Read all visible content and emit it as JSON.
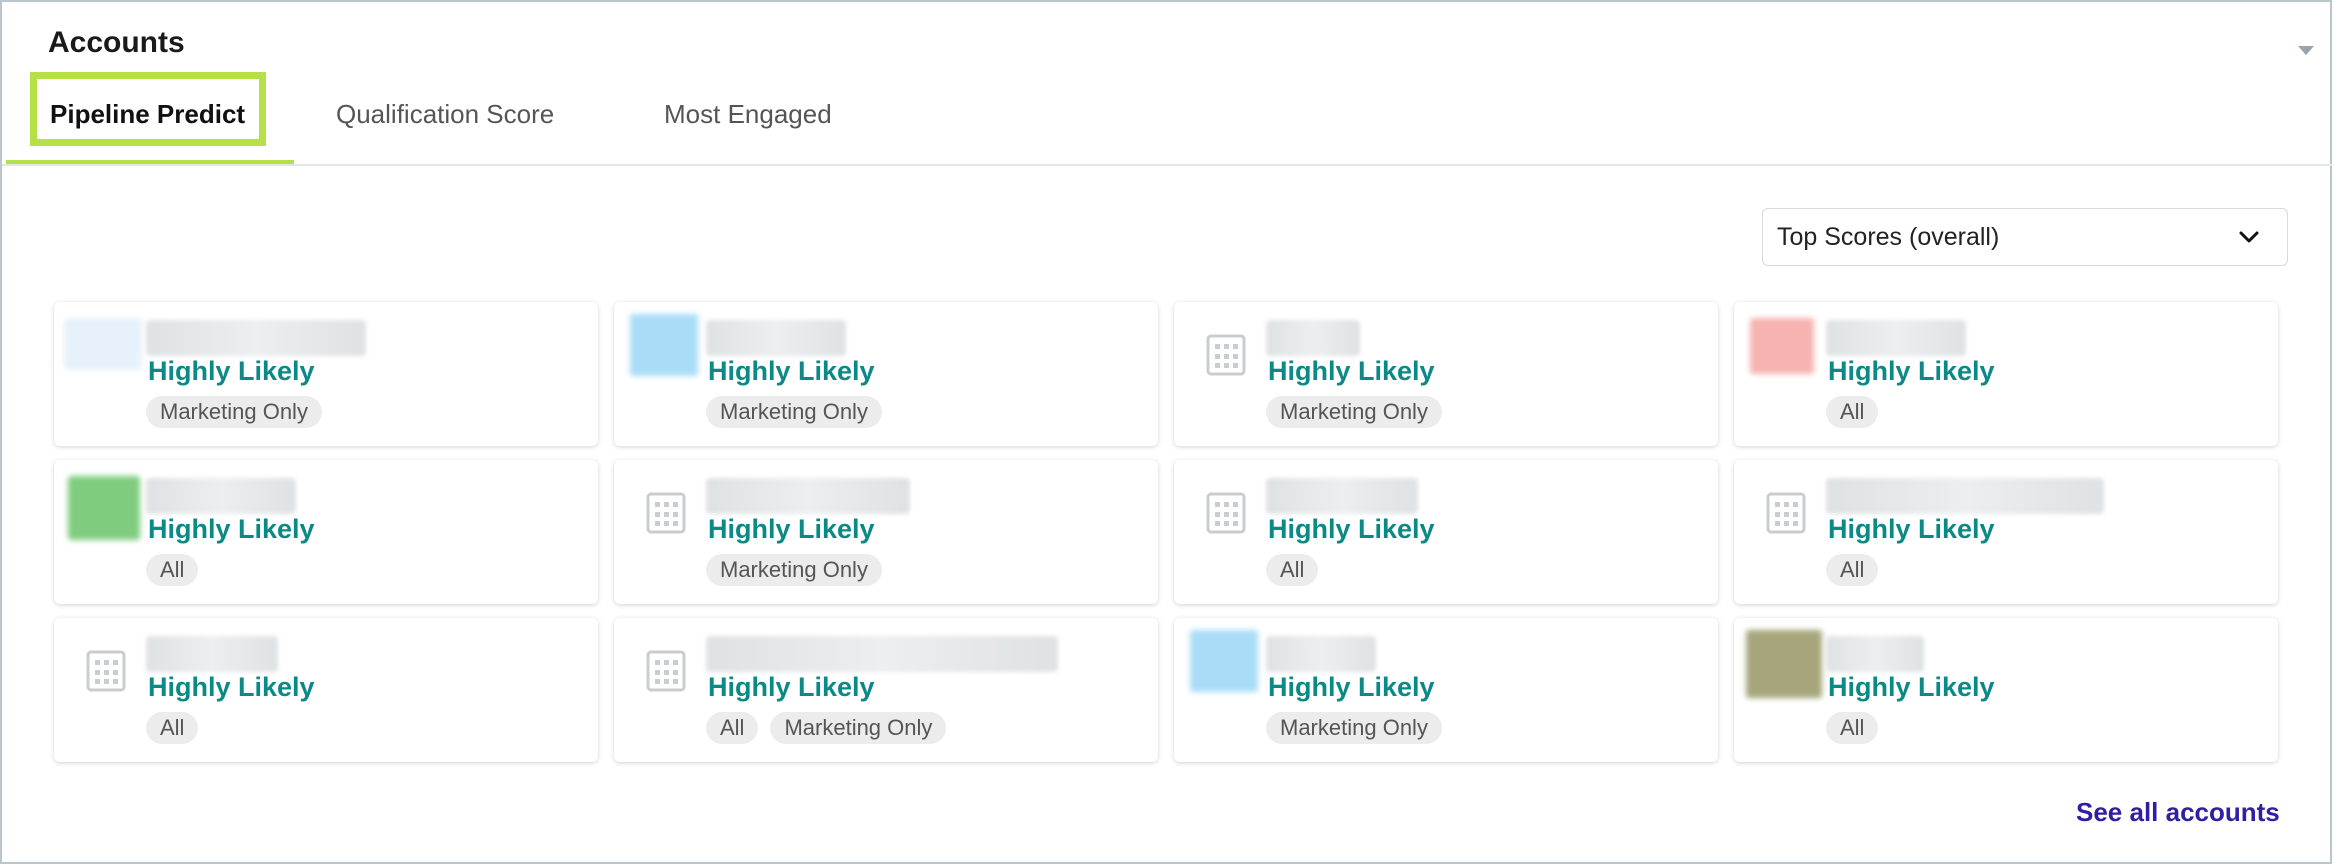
{
  "title": "Accounts",
  "tabs": [
    {
      "label": "Pipeline Predict",
      "active": true
    },
    {
      "label": "Qualification Score",
      "active": false
    },
    {
      "label": "Most Engaged",
      "active": false
    }
  ],
  "sort_dropdown": {
    "selected": "Top Scores (overall)"
  },
  "colors": {
    "accent": "#b6e047",
    "likely": "#0a8a86",
    "link": "#2e1fa3"
  },
  "accounts": [
    {
      "likelihood": "Highly Likely",
      "tags": [
        "Marketing Only"
      ],
      "logo": "blue-light"
    },
    {
      "likelihood": "Highly Likely",
      "tags": [
        "Marketing Only"
      ],
      "logo": "blue"
    },
    {
      "likelihood": "Highly Likely",
      "tags": [
        "Marketing Only"
      ],
      "logo": "building-icon"
    },
    {
      "likelihood": "Highly Likely",
      "tags": [
        "All"
      ],
      "logo": "red"
    },
    {
      "likelihood": "Highly Likely",
      "tags": [
        "All"
      ],
      "logo": "green"
    },
    {
      "likelihood": "Highly Likely",
      "tags": [
        "Marketing Only"
      ],
      "logo": "building-icon"
    },
    {
      "likelihood": "Highly Likely",
      "tags": [
        "All"
      ],
      "logo": "building-icon"
    },
    {
      "likelihood": "Highly Likely",
      "tags": [
        "All"
      ],
      "logo": "building-icon"
    },
    {
      "likelihood": "Highly Likely",
      "tags": [
        "All"
      ],
      "logo": "building-icon"
    },
    {
      "likelihood": "Highly Likely",
      "tags": [
        "All",
        "Marketing Only"
      ],
      "logo": "building-icon"
    },
    {
      "likelihood": "Highly Likely",
      "tags": [
        "Marketing Only"
      ],
      "logo": "blue"
    },
    {
      "likelihood": "Highly Likely",
      "tags": [
        "All"
      ],
      "logo": "olive"
    }
  ],
  "see_all_label": "See all accounts"
}
